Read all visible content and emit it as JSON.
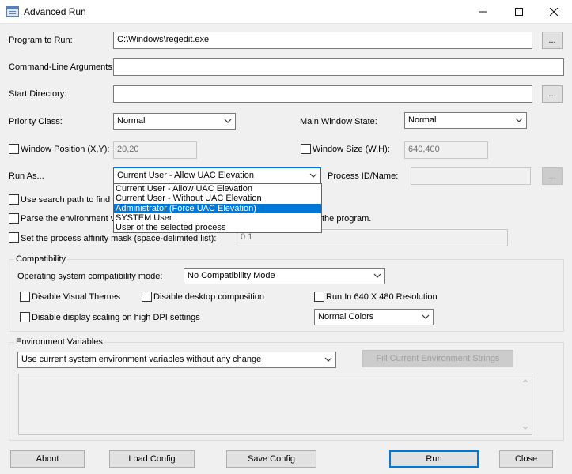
{
  "window": {
    "title": "Advanced Run"
  },
  "program": {
    "label": "Program to Run:",
    "value": "C:\\Windows\\regedit.exe",
    "browse": "..."
  },
  "args": {
    "label": "Command-Line Arguments:",
    "value": ""
  },
  "startdir": {
    "label": "Start Directory:",
    "value": "",
    "browse": "..."
  },
  "priority": {
    "label": "Priority Class:",
    "value": "Normal"
  },
  "winstate": {
    "label": "Main Window State:",
    "value": "Normal"
  },
  "winpos": {
    "label": "Window Position (X,Y):",
    "value": "20,20"
  },
  "winsize": {
    "label": "Window Size (W,H):",
    "value": "640,400"
  },
  "runas": {
    "label": "Run As...",
    "value": "Current User - Allow UAC Elevation",
    "options": [
      "Current User - Allow UAC Elevation",
      "Current User - Without UAC Elevation",
      "Administrator (Force UAC Elevation)",
      "SYSTEM User",
      "User of the selected process"
    ],
    "highlighted_index": 2
  },
  "pid": {
    "label": "Process ID/Name:",
    "value": "",
    "browse": "..."
  },
  "search_path": {
    "label_visible": "Use search path to find th"
  },
  "parse_env": {
    "label_visible": "Parse the environment va",
    "label_tail": "the program."
  },
  "affinity": {
    "label": "Set the process affinity mask (space-delimited list):",
    "value": "0 1"
  },
  "compat": {
    "title": "Compatibility",
    "os_label": "Operating system compatibility mode:",
    "os_value": "No Compatibility Mode",
    "disable_themes": "Disable Visual Themes",
    "disable_composition": "Disable desktop composition",
    "run_640": "Run In 640 X 480 Resolution",
    "disable_dpi": "Disable display scaling on high DPI settings",
    "colors_value": "Normal Colors"
  },
  "env": {
    "title": "Environment Variables",
    "mode_value": "Use current system environment variables without any change",
    "fill_button": "Fill Current Environment Strings",
    "text": ""
  },
  "footer": {
    "about": "About",
    "load": "Load Config",
    "save": "Save Config",
    "run": "Run",
    "close": "Close"
  },
  "colors": {
    "accent": "#0078d7",
    "window_bg": "#f0f0f0"
  }
}
